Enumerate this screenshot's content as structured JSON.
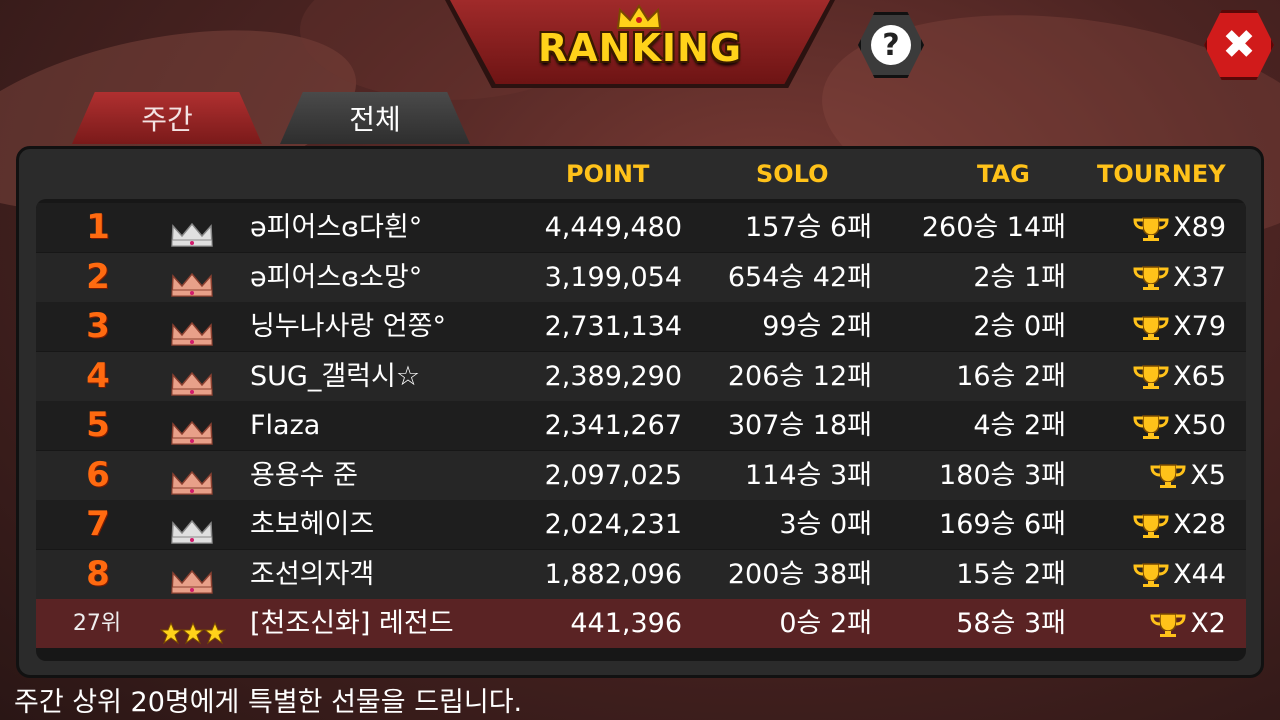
{
  "header": {
    "title": "RANKING",
    "help_label": "?",
    "close_label": "✖"
  },
  "tabs": [
    {
      "label": "주간",
      "active": true
    },
    {
      "label": "전체",
      "active": false
    }
  ],
  "columns": {
    "point": "POINT",
    "solo": "SOLO",
    "tag": "TAG",
    "tourney": "TOURNEY"
  },
  "rows": [
    {
      "rank": "1",
      "crown": "silver",
      "name": "ə피어스ɞ다흰°",
      "point": "4,449,480",
      "solo": "157승 6패",
      "tag": "260승 14패",
      "tourney": "X89"
    },
    {
      "rank": "2",
      "crown": "bronze",
      "name": "ə피어스ɞ소망°",
      "point": "3,199,054",
      "solo": "654승 42패",
      "tag": "2승 1패",
      "tourney": "X37"
    },
    {
      "rank": "3",
      "crown": "bronze",
      "name": "닝누나사랑 언쫑°",
      "point": "2,731,134",
      "solo": "99승 2패",
      "tag": "2승 0패",
      "tourney": "X79"
    },
    {
      "rank": "4",
      "crown": "bronze",
      "name": "SUG_갤럭시☆",
      "point": "2,389,290",
      "solo": "206승 12패",
      "tag": "16승 2패",
      "tourney": "X65"
    },
    {
      "rank": "5",
      "crown": "bronze",
      "name": "Flaza",
      "point": "2,341,267",
      "solo": "307승 18패",
      "tag": "4승 2패",
      "tourney": "X50"
    },
    {
      "rank": "6",
      "crown": "bronze",
      "name": "용용수 준",
      "point": "2,097,025",
      "solo": "114승 3패",
      "tag": "180승 3패",
      "tourney": "X5"
    },
    {
      "rank": "7",
      "crown": "silver",
      "name": "초보헤이즈",
      "point": "2,024,231",
      "solo": "3승 0패",
      "tag": "169승 6패",
      "tourney": "X28"
    },
    {
      "rank": "8",
      "crown": "bronze",
      "name": "조선의자객",
      "point": "1,882,096",
      "solo": "200승 38패",
      "tag": "15승 2패",
      "tourney": "X44"
    }
  ],
  "my_row": {
    "rank": "27위",
    "stars": 3,
    "name": "[천조신화] 레전드",
    "point": "441,396",
    "solo": "0승 2패",
    "tag": "58승 3패",
    "tourney": "X2"
  },
  "footer": "주간 상위 20명에게 특별한 선물을 드립니다.",
  "colors": {
    "header_gold": "#ffc21a",
    "rank_orange": "#ff6a10",
    "my_row_bg": "#5a2324",
    "close_red": "#d11b1b"
  }
}
